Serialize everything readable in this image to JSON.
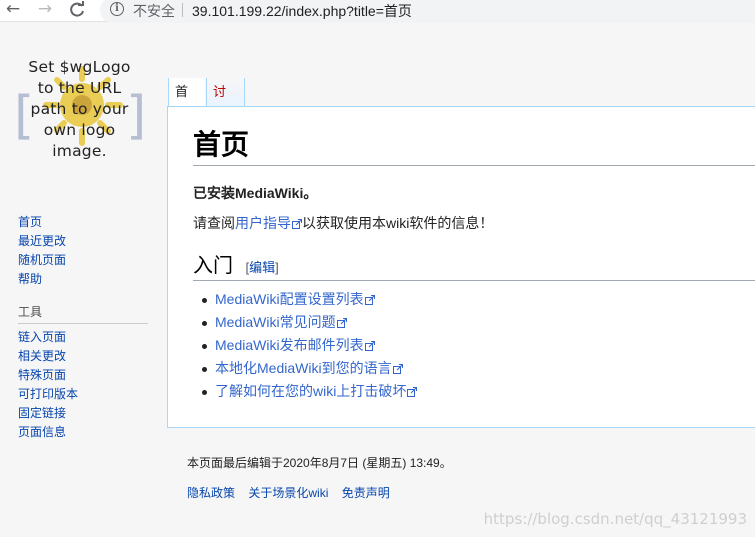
{
  "browser": {
    "back_icon": "back-arrow-icon",
    "forward_icon": "forward-arrow-icon",
    "reload_icon": "reload-icon",
    "security_label": "不安全",
    "url": "39.101.199.22/index.php?title=首页"
  },
  "logo": {
    "lines": [
      "Set $wgLogo",
      "to the URL",
      "path to your",
      "own logo",
      "image."
    ]
  },
  "navigation": {
    "items": [
      "首页",
      "最近更改",
      "随机页面",
      "帮助"
    ]
  },
  "tools": {
    "heading": "工具",
    "items": [
      "链入页面",
      "相关更改",
      "特殊页面",
      "可打印版本",
      "固定链接",
      "页面信息"
    ]
  },
  "tabs": {
    "page": "首页",
    "talk": "讨论"
  },
  "content": {
    "title": "首页",
    "installed": "已安装MediaWiki。",
    "consult_prefix": "请查阅",
    "consult_link": "用户指导",
    "consult_suffix": "以获取使用本wiki软件的信息！",
    "section_title": "入门",
    "edit_open": "[",
    "edit_label": "编辑",
    "edit_close": "]",
    "links": [
      "MediaWiki配置设置列表",
      "MediaWiki常见问题",
      "MediaWiki发布邮件列表",
      "本地化MediaWiki到您的语言",
      "了解如何在您的wiki上打击破坏"
    ]
  },
  "footer": {
    "last_modified": "本页面最后编辑于2020年8月7日 (星期五) 13:49。",
    "links": [
      "隐私政策",
      "关于场景化wiki",
      "免责声明"
    ]
  },
  "watermark": "https://blog.csdn.net/qq_43121993",
  "colors": {
    "link": "#3366cc",
    "nav_link": "#0645ad",
    "talk_tab": "#ba0000",
    "border": "#a7d7f9"
  }
}
